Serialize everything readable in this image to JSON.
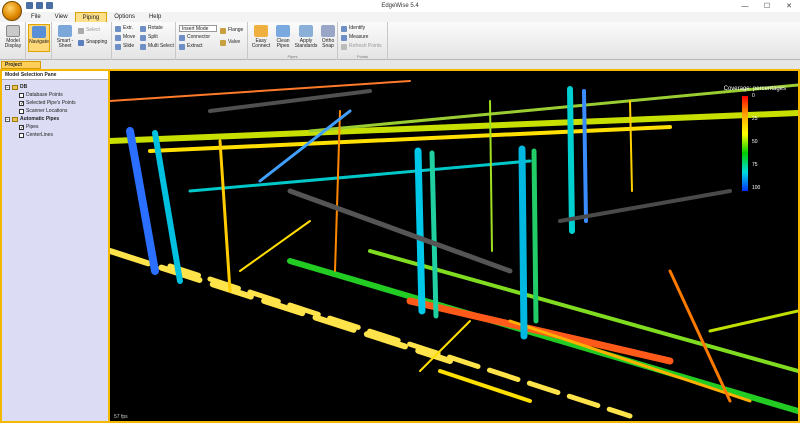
{
  "window": {
    "title": "EdgeWise 5.4",
    "minimize": "—",
    "maximize": "☐",
    "close": "✕"
  },
  "menu": {
    "tabs": [
      {
        "label": "File"
      },
      {
        "label": "View"
      },
      {
        "label": "Piping"
      },
      {
        "label": "Options"
      },
      {
        "label": "Help"
      }
    ]
  },
  "ribbon": {
    "model_display": "Model Display",
    "navigate": "Navigate",
    "smart_sheet": "Smart - Sheet",
    "select": "Select",
    "snapping": "Snapping",
    "extr": "Extr.",
    "move": "Move",
    "slide": "Slide",
    "rotate": "Rotate",
    "split": "Split",
    "multi_select": "Multi Select",
    "insert_mode": "Insert Mode",
    "connector": "Connector",
    "extract": "Extract",
    "flange": "Flange",
    "valve": "Valve",
    "easy_connect": "Easy Connect",
    "clean_pipes": "Clean Pipes",
    "apply_standards": "Apply Standards",
    "ortho_snap": "Ortho Snap",
    "identify": "Identify",
    "measure": "Measure",
    "refresh_points": "Refresh Points",
    "group_pipes": "Pipes",
    "group_points": "Points"
  },
  "project_tab": {
    "label": "Project"
  },
  "panel": {
    "title": "Model Selection Pane",
    "db": "DB",
    "database_points": "Database Points",
    "selected_pipes_points": "Selected Pipe's Points",
    "scanner_locations": "Scanner Locations",
    "automatic_pipes": "Automatic Pipes",
    "pipes": "Pipes",
    "centerlines": "CenterLines"
  },
  "viewport": {
    "legend_title": "Coverage: percentages",
    "legend_ticks": [
      "0",
      "25",
      "50",
      "75",
      "100"
    ],
    "fps": "57 fps"
  },
  "colors": {
    "accent": "#f4b800",
    "legend_top": "#ff0000",
    "legend_bottom": "#0033ff"
  }
}
